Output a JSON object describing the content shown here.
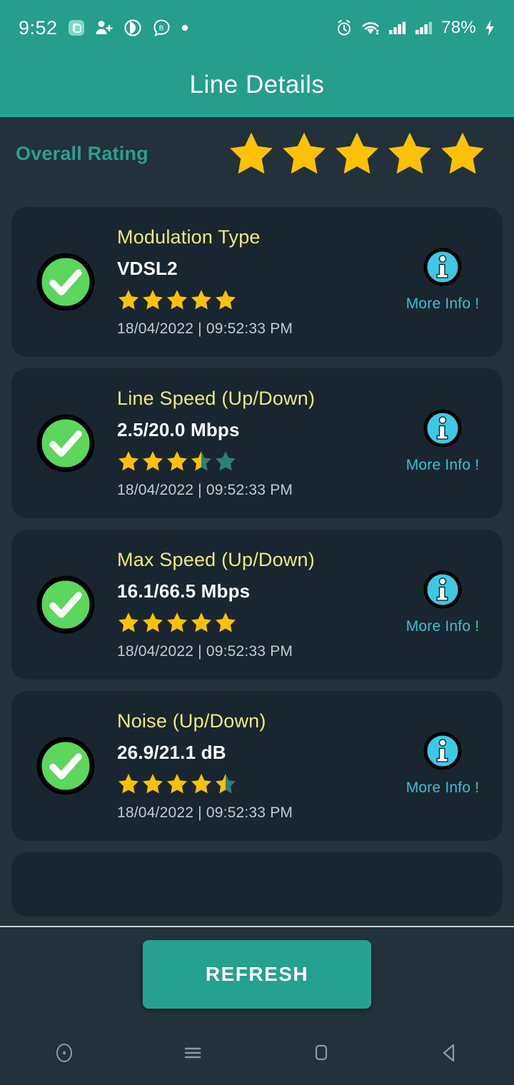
{
  "status_bar": {
    "time": "9:52",
    "battery": "78%",
    "left_icons": [
      "app-badge-icon",
      "add-contact-icon",
      "play-circle-icon",
      "bubble-b-icon",
      "dot-icon"
    ],
    "right_icons": [
      "alarm-icon",
      "wifi-icon",
      "signal-sim1-icon",
      "signal-sim2-icon",
      "charging-bolt-icon"
    ]
  },
  "header": {
    "title": "Line Details",
    "bar_color": "#259E8C",
    "accent_color": "#19AFA0"
  },
  "overall": {
    "label": "Overall Rating",
    "label_color": "#2E9E90",
    "stars": 5,
    "max_stars": 5
  },
  "colors": {
    "page_bg": "#22313A",
    "card_bg": "#19262F",
    "star_full": "#FFC107",
    "star_empty": "#2E8077",
    "title_yellow": "#F0E87C",
    "info_cyan": "#34C0D8",
    "check_green": "#5BD75B",
    "button_teal": "#24A18F"
  },
  "cards": [
    {
      "status_icon": "check-circle-icon",
      "title": "Modulation Type",
      "value": "VDSL2",
      "stars": 5,
      "timestamp": "18/04/2022 | 09:52:33 PM",
      "info_icon": "info-icon",
      "info_label": "More Info !"
    },
    {
      "status_icon": "check-circle-icon",
      "title": "Line Speed (Up/Down)",
      "value": "2.5/20.0 Mbps",
      "stars": 3.5,
      "timestamp": "18/04/2022 | 09:52:33 PM",
      "info_icon": "info-icon",
      "info_label": "More Info !"
    },
    {
      "status_icon": "check-circle-icon",
      "title": "Max Speed (Up/Down)",
      "value": "16.1/66.5 Mbps",
      "stars": 5,
      "timestamp": "18/04/2022 | 09:52:33 PM",
      "info_icon": "info-icon",
      "info_label": "More Info !"
    },
    {
      "status_icon": "check-circle-icon",
      "title": "Noise (Up/Down)",
      "value": "26.9/21.1 dB",
      "stars": 4.5,
      "timestamp": "18/04/2022 | 09:52:33 PM",
      "info_icon": "info-icon",
      "info_label": "More Info !"
    }
  ],
  "footer": {
    "refresh_label": "REFRESH"
  },
  "nav_bar": {
    "items": [
      "assistant-icon",
      "recents-icon",
      "home-icon",
      "back-icon"
    ]
  }
}
